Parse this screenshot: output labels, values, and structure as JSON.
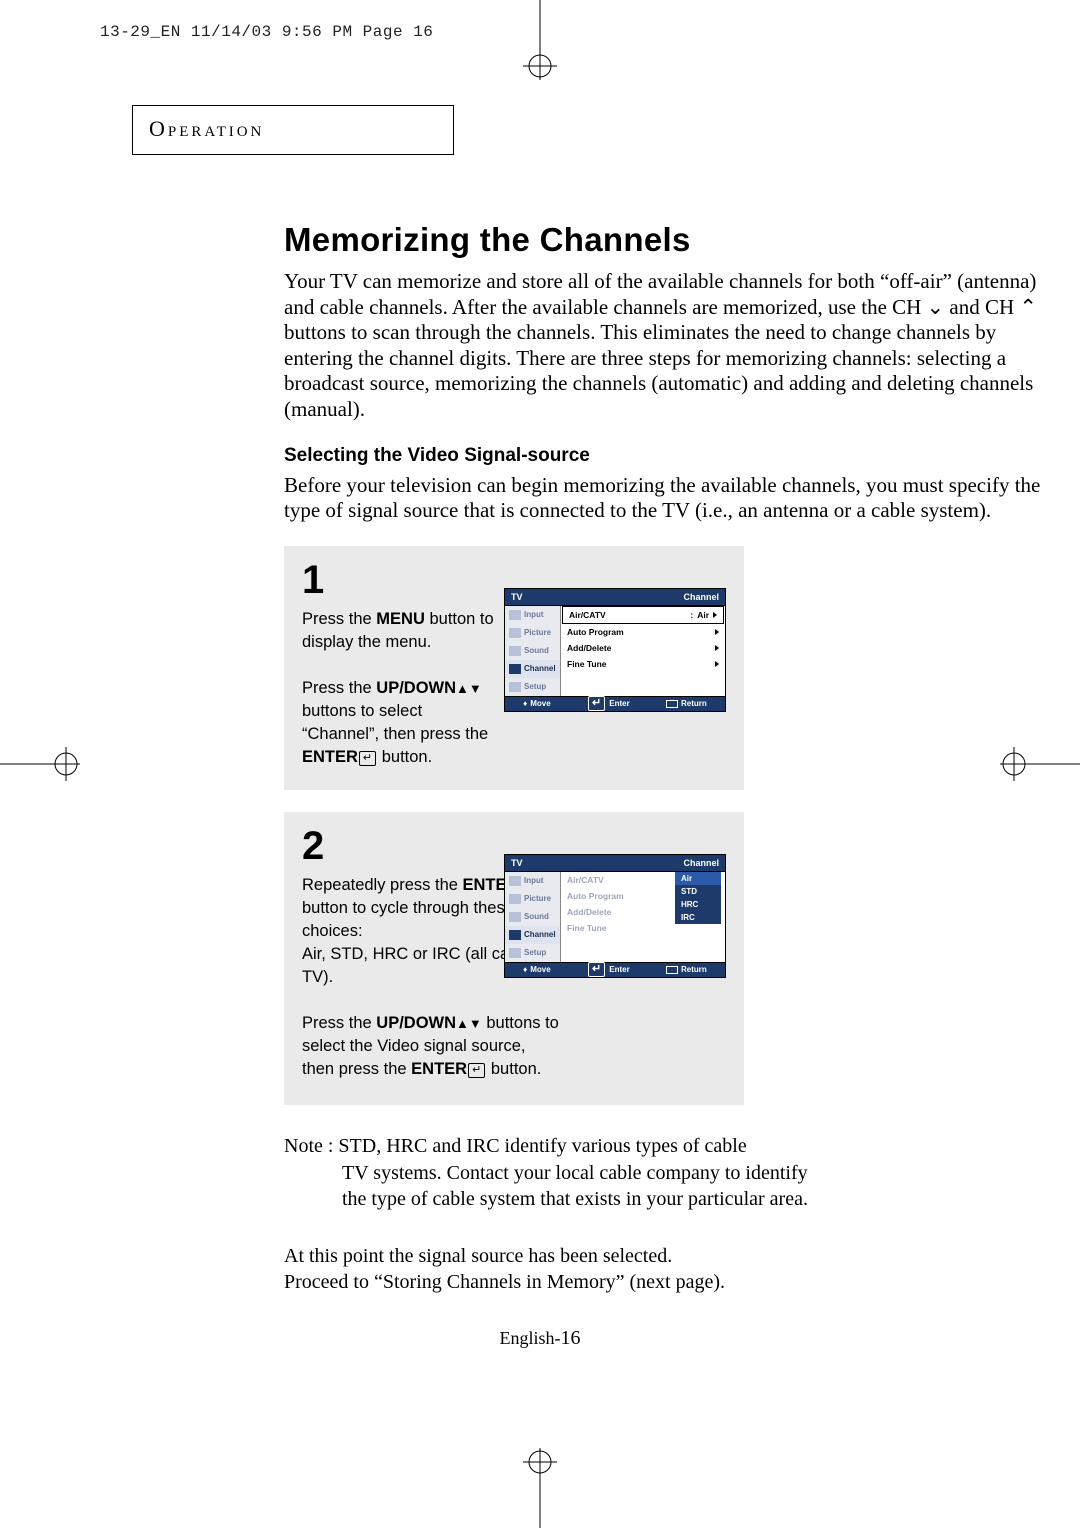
{
  "print_header": "13-29_EN  11/14/03 9:56 PM  Page 16",
  "section_title": "Operation",
  "heading": "Memorizing the Channels",
  "intro_html": "Your TV can memorize and store all of the available channels for both “off-air” (antenna) and cable channels. After the available channels are memorized, use the CH ⌄ and CH ⌃ buttons to scan through the channels. This eliminates the need to change channels by entering the channel digits. There are three steps for memorizing channels: selecting a broadcast source, memorizing the channels (automatic) and adding and deleting channels (manual).",
  "subheading": "Selecting the Video Signal-source",
  "sub_body": "Before your television can begin memorizing the available channels, you must specify the type of signal source that is connected to the TV (i.e., an antenna or a cable system).",
  "steps": {
    "s1": {
      "num": "1",
      "para1_pre": "Press the ",
      "para1_bold": "MENU",
      "para1_post": " button to display the menu.",
      "para2_pre": "Press the ",
      "para2_bold": "UP/DOWN",
      "para2_mid": " buttons to select “Channel”, then press the ",
      "para2_bold2": "ENTER",
      "para2_post": "   button."
    },
    "s2": {
      "num": "2",
      "para1_pre": "Repeatedly press the ",
      "para1_bold": "ENTER",
      "para1_post": "   button to cycle through these choices:",
      "para1_line2": "Air, STD, HRC or IRC (all cable TV).",
      "para2_pre": "Press the ",
      "para2_bold": "UP/DOWN",
      "para2_mid": " buttons to select the Video signal source, then press the ",
      "para2_bold2": "ENTER",
      "para2_post": "    button."
    }
  },
  "osd": {
    "title_left": "TV",
    "title_right": "Channel",
    "side": [
      "Input",
      "Picture",
      "Sound",
      "Channel",
      "Setup"
    ],
    "rows": [
      "Air/CATV",
      "Auto Program",
      "Add/Delete",
      "Fine Tune"
    ],
    "value1": "Air",
    "popup": [
      "Air",
      "STD",
      "HRC",
      "IRC"
    ],
    "footer_move": "Move",
    "footer_enter": "Enter",
    "footer_return": "Return"
  },
  "note_line1": "Note : STD, HRC and IRC  identify various types of cable",
  "note_line2": "TV systems. Contact your local cable company to identify",
  "note_line3": "the type of cable system that exists in your particular area.",
  "final1": "At this point the signal source has been selected.",
  "final2": "Proceed to “Storing Channels in Memory” (next page).",
  "footer_label": "English-",
  "footer_page": "16"
}
